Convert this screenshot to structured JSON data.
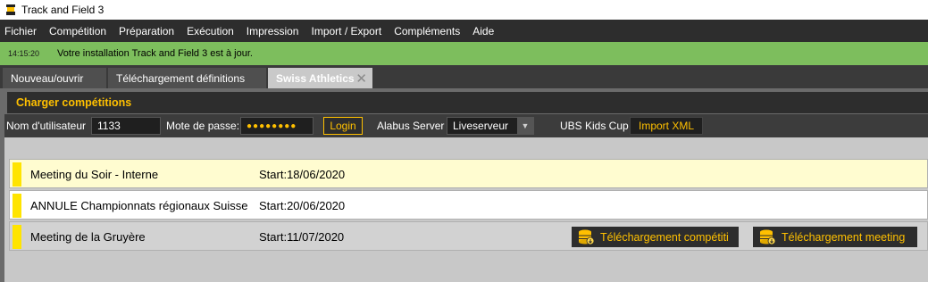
{
  "window": {
    "title": "Track and Field 3",
    "app_icon": "app-icon"
  },
  "menu": [
    "Fichier",
    "Compétition",
    "Préparation",
    "Exécution",
    "Impression",
    "Import / Export",
    "Compléments",
    "Aide"
  ],
  "notification": {
    "time": "14:15:20",
    "message": "Votre installation Track and Field 3 est à jour.",
    "color": "#7dbe5d"
  },
  "tabs": [
    {
      "label": "Nouveau/ouvrir",
      "active": false
    },
    {
      "label": "Téléchargement définitions",
      "active": false
    },
    {
      "label": "Swiss Athletics",
      "active": true,
      "close_icon": "close-icon"
    }
  ],
  "section": {
    "title": "Charger compétitions"
  },
  "login": {
    "username_label": "Nom d'utilisateur",
    "username_value": "1133",
    "password_label": "Mote de passe:",
    "password_value": "●●●●●●●●",
    "login_button": "Login",
    "server_label": "Alabus Server",
    "server_value": "Liveserveur",
    "kids_cup_label": "UBS Kids Cup",
    "import_button": "Import XML"
  },
  "competitions": [
    {
      "name": "Meeting du Soir - Interne",
      "start": "Start:18/06/2020",
      "selected": true
    },
    {
      "name": "ANNULE Championnats régionaux Suisse",
      "start": "Start:20/06/2020",
      "selected": false
    },
    {
      "name": "Meeting de la Gruyère",
      "start": "Start:11/07/2020",
      "selected": false,
      "actions": [
        "Téléchargement compétiti",
        "Téléchargement meeting"
      ]
    }
  ],
  "colors": {
    "accent": "#ffc000",
    "marker": "#ffe400",
    "menubar": "#2d2d2d",
    "selected_row": "#fffcd0"
  }
}
